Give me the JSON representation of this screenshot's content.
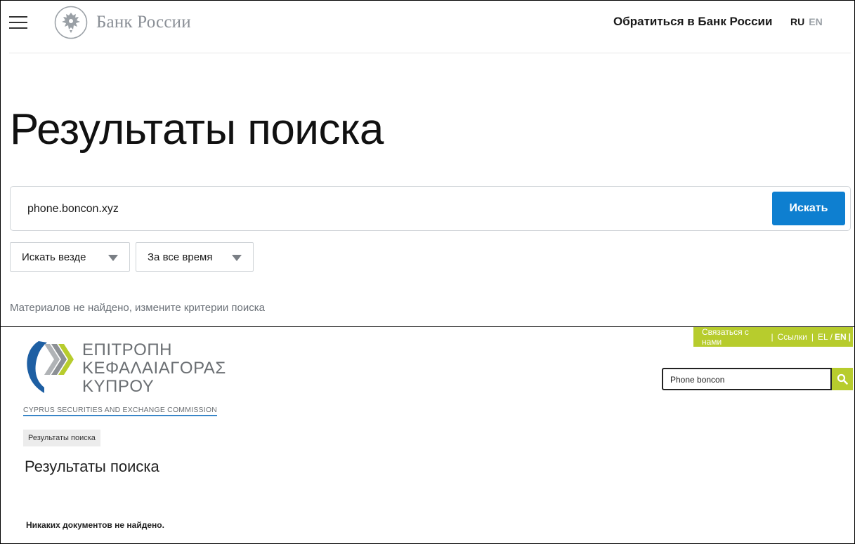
{
  "cbr": {
    "logo_text": "Банк России",
    "header_link": "Обратиться в Банк России",
    "lang": {
      "ru": "RU",
      "en": "EN"
    },
    "page_title": "Результаты поиска",
    "search": {
      "value": "phone.boncon.xyz",
      "button": "Искать"
    },
    "filters": {
      "scope": "Искать везде",
      "period": "За все время"
    },
    "empty_message": "Материалов не найдено, измените критерии поиска",
    "colors": {
      "button": "#0e7fd0",
      "muted": "#6b7178"
    }
  },
  "cysec": {
    "topbar": {
      "contact": "Связаться с нами",
      "links": "Ссылки",
      "el": "EL",
      "en": "EN"
    },
    "logo_greek": [
      "ΕΠΙΤΡΟΠΗ",
      "ΚΕΦΑΛΑΙΑΓΟΡΑΣ",
      "ΚΥΠΡΟΥ"
    ],
    "logo_english": "CYPRUS SECURITIES AND EXCHANGE COMMISSION",
    "search": {
      "value": "Phone boncon"
    },
    "breadcrumb": "Результаты поиска",
    "page_title": "Результаты поиска",
    "empty_message": "Никаких документов не найдено.",
    "colors": {
      "accent": "#b7cc2d"
    }
  }
}
